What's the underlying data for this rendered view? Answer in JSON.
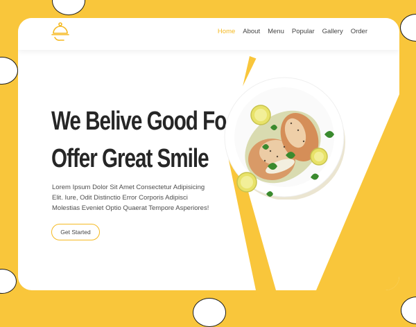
{
  "nav": {
    "items": [
      {
        "label": "Home",
        "active": true
      },
      {
        "label": "About",
        "active": false
      },
      {
        "label": "Menu",
        "active": false
      },
      {
        "label": "Popular",
        "active": false
      },
      {
        "label": "Gallery",
        "active": false
      },
      {
        "label": "Order",
        "active": false
      }
    ]
  },
  "hero": {
    "title_line1": "We Belive Good Food",
    "title_line2": "Offer Great Smile",
    "description": "Lorem Ipsum Dolor Sit Amet Consectetur Adipisicing Elit. Iure, Odit Distinctio Error Corporis Adipisci Molestias Eveniet Optio Quaerat Tempore Asperiores!",
    "cta_label": "Get Started"
  },
  "colors": {
    "accent": "#f5b921",
    "background": "#f9c63b",
    "card": "#ffffff",
    "text": "#262626"
  },
  "icons": {
    "logo": "serving-cloche-icon"
  }
}
